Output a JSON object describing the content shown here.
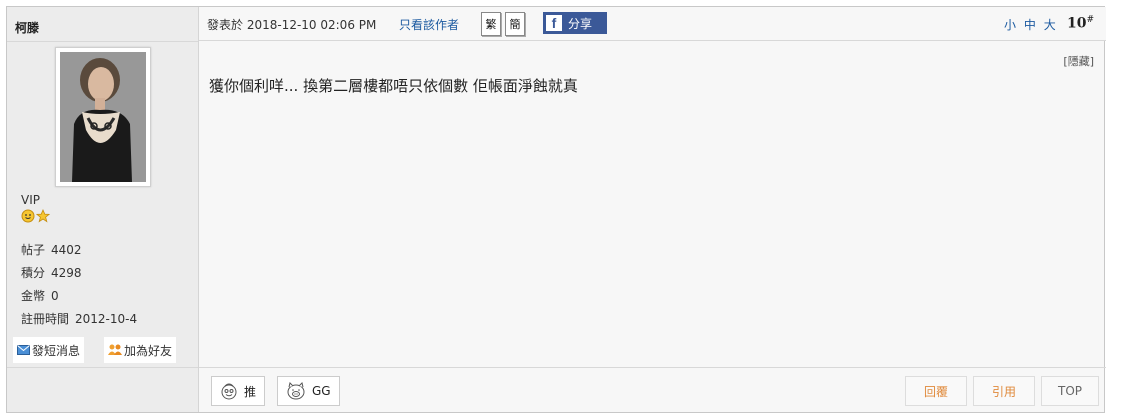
{
  "author": {
    "name": "柯滕",
    "rank": "VIP",
    "stats": [
      {
        "label": "帖子",
        "value": "4402"
      },
      {
        "label": "積分",
        "value": "4298"
      },
      {
        "label": "金幣",
        "value": "0"
      },
      {
        "label": "註冊時間",
        "value": "2012-10-4"
      }
    ],
    "send_message_label": "發短消息",
    "add_friend_label": "加為好友"
  },
  "post": {
    "time": "發表於 2018-12-10 02:06 PM",
    "only_author_label": "只看該作者",
    "traditional_label": "繁",
    "simplified_label": "簡",
    "share_label": "分享",
    "font_sizes": [
      "小",
      "中",
      "大"
    ],
    "floor": "10",
    "floor_mark": "#",
    "hide_label": "[隱藏]",
    "body": "獲你個利咩... 換第二層樓都唔只依個數  佢帳面淨蝕就真"
  },
  "footer": {
    "push_label": "推",
    "gg_label": "GG",
    "reply_label": "回覆",
    "quote_label": "引用",
    "top_label": "TOP"
  },
  "colors": {
    "link": "#1c5aa0",
    "facebook": "#3b5998",
    "reply_text": "#e08a3c"
  },
  "icons": {
    "facebook": "facebook-logo-icon",
    "message": "envelope-icon",
    "friend": "people-icon",
    "push": "face-icon",
    "gg": "pig-icon",
    "star": "star-icon",
    "smiley": "smiley-icon"
  }
}
